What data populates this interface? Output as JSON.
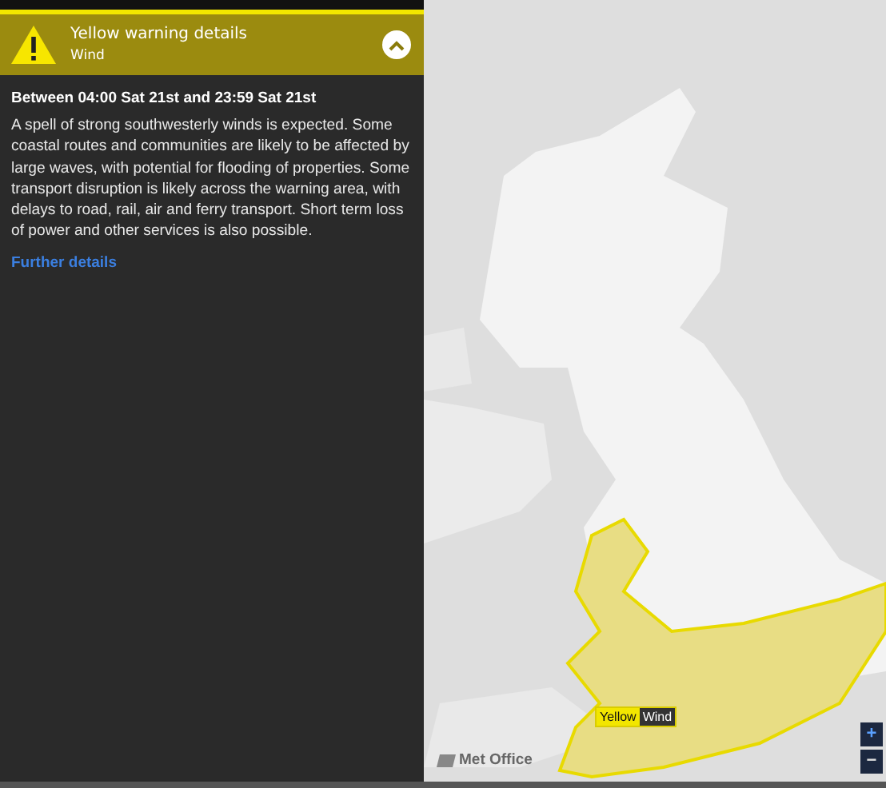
{
  "header": {
    "title": "Yellow warning details",
    "subtitle": "Wind",
    "expanded": true
  },
  "period": "Between 04:00 Sat 21st and 23:59 Sat 21st",
  "description": "A spell of strong southwesterly winds is expected. Some coastal routes and communities are likely to be affected by large waves, with potential for flooding of properties. Some transport disruption is likely across the warning area, with delays to road, rail, air and ferry transport. Short term loss of power and other services is also possible.",
  "link": "Further details",
  "map": {
    "kind": "picture",
    "warning_tag": {
      "level": "Yellow",
      "type": "Wind"
    },
    "attribution": "Met Office",
    "zoom_controls": [
      "+",
      "−"
    ]
  }
}
